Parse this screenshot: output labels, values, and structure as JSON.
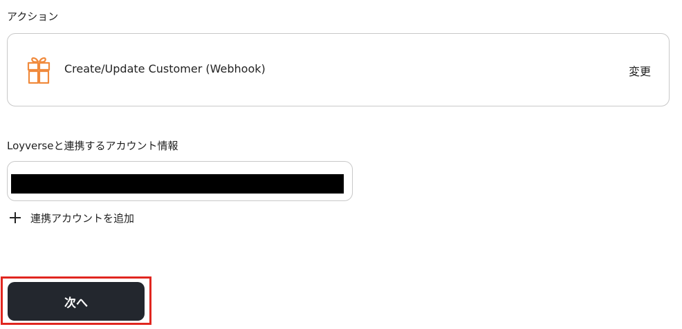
{
  "action_section": {
    "label": "アクション",
    "action_name": "Create/Update Customer (Webhook)",
    "change_label": "変更",
    "icon": "gift-icon",
    "icon_color": "#f08a3c"
  },
  "account_section": {
    "label": "Loyverseと連携するアカウント情報",
    "add_account_label": "連携アカウントを追加",
    "add_icon": "plus-icon"
  },
  "footer": {
    "next_label": "次へ",
    "next_button_color": "#23272e",
    "highlight_color": "#e0261f"
  }
}
